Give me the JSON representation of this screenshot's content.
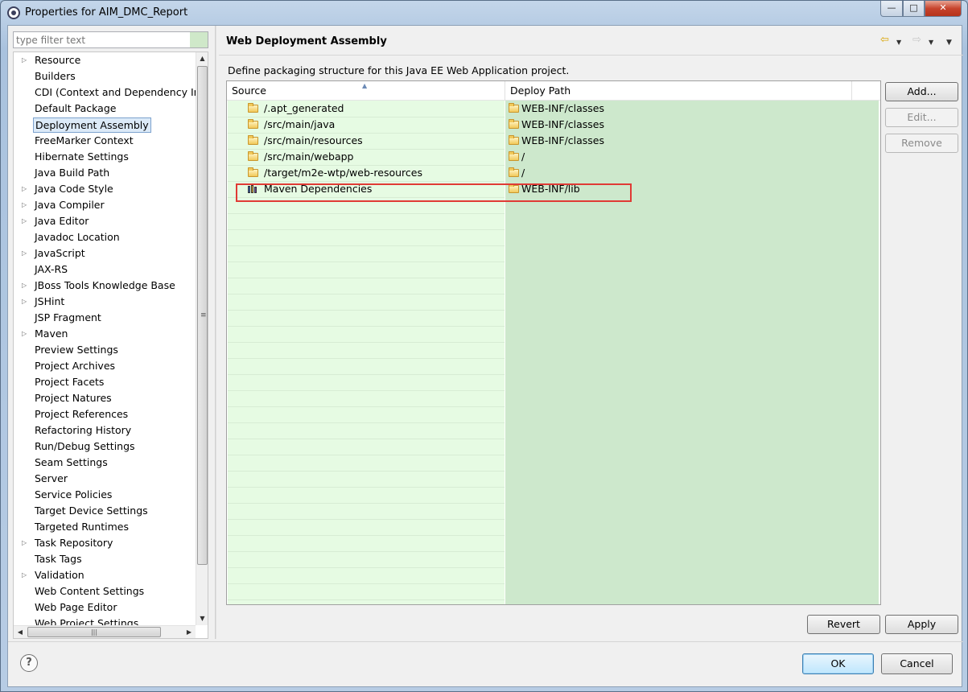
{
  "window": {
    "title": "Properties for AIM_DMC_Report",
    "minimize": "—",
    "maximize": "□",
    "close": "✕"
  },
  "filter": {
    "placeholder": "type filter text"
  },
  "tree": {
    "items": [
      {
        "label": "Resource",
        "expandable": true
      },
      {
        "label": "Builders",
        "expandable": false
      },
      {
        "label": "CDI (Context and Dependency Injection)",
        "expandable": false
      },
      {
        "label": "Default Package",
        "expandable": false
      },
      {
        "label": "Deployment Assembly",
        "expandable": false,
        "selected": true
      },
      {
        "label": "FreeMarker Context",
        "expandable": false
      },
      {
        "label": "Hibernate Settings",
        "expandable": false
      },
      {
        "label": "Java Build Path",
        "expandable": false
      },
      {
        "label": "Java Code Style",
        "expandable": true
      },
      {
        "label": "Java Compiler",
        "expandable": true
      },
      {
        "label": "Java Editor",
        "expandable": true
      },
      {
        "label": "Javadoc Location",
        "expandable": false
      },
      {
        "label": "JavaScript",
        "expandable": true
      },
      {
        "label": "JAX-RS",
        "expandable": false
      },
      {
        "label": "JBoss Tools Knowledge Base",
        "expandable": true
      },
      {
        "label": "JSHint",
        "expandable": true
      },
      {
        "label": "JSP Fragment",
        "expandable": false
      },
      {
        "label": "Maven",
        "expandable": true
      },
      {
        "label": "Preview Settings",
        "expandable": false
      },
      {
        "label": "Project Archives",
        "expandable": false
      },
      {
        "label": "Project Facets",
        "expandable": false
      },
      {
        "label": "Project Natures",
        "expandable": false
      },
      {
        "label": "Project References",
        "expandable": false
      },
      {
        "label": "Refactoring History",
        "expandable": false
      },
      {
        "label": "Run/Debug Settings",
        "expandable": false
      },
      {
        "label": "Seam Settings",
        "expandable": false
      },
      {
        "label": "Server",
        "expandable": false
      },
      {
        "label": "Service Policies",
        "expandable": false
      },
      {
        "label": "Target Device Settings",
        "expandable": false
      },
      {
        "label": "Targeted Runtimes",
        "expandable": false
      },
      {
        "label": "Task Repository",
        "expandable": true
      },
      {
        "label": "Task Tags",
        "expandable": false
      },
      {
        "label": "Validation",
        "expandable": true
      },
      {
        "label": "Web Content Settings",
        "expandable": false
      },
      {
        "label": "Web Page Editor",
        "expandable": false
      },
      {
        "label": "Web Project Settings",
        "expandable": false
      }
    ]
  },
  "page": {
    "title": "Web Deployment Assembly",
    "description": "Define packaging structure for this Java EE Web Application project.",
    "nav": {
      "back": "⇦",
      "forward": "⇨",
      "dropdown": "▼",
      "menu": "▼"
    }
  },
  "table": {
    "columns": {
      "source": "Source",
      "deploy": "Deploy Path"
    },
    "rows": [
      {
        "source": "/.apt_generated",
        "source_icon": "folder-icon",
        "deploy": "WEB-INF/classes"
      },
      {
        "source": "/src/main/java",
        "source_icon": "folder-icon",
        "deploy": "WEB-INF/classes"
      },
      {
        "source": "/src/main/resources",
        "source_icon": "folder-icon",
        "deploy": "WEB-INF/classes"
      },
      {
        "source": "/src/main/webapp",
        "source_icon": "folder-icon",
        "deploy": "/"
      },
      {
        "source": "/target/m2e-wtp/web-resources",
        "source_icon": "folder-icon",
        "deploy": "/"
      },
      {
        "source": "Maven Dependencies",
        "source_icon": "library-icon",
        "deploy": "WEB-INF/lib"
      }
    ],
    "highlight_color": "#e03a35"
  },
  "buttons": {
    "add": "Add...",
    "edit": "Edit...",
    "remove": "Remove",
    "revert": "Revert",
    "apply": "Apply",
    "ok": "OK",
    "cancel": "Cancel",
    "help": "?"
  },
  "colors": {
    "source_column_bg": "#e6fbe3",
    "deploy_column_bg": "#cde8cc",
    "selection": "#dceaf8"
  }
}
